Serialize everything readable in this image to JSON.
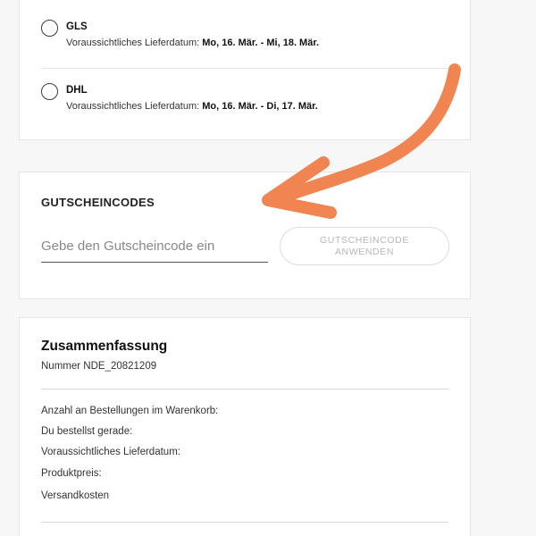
{
  "shipping": {
    "options": [
      {
        "carrier": "GLS",
        "eta_label": "Voraussichtliches Lieferdatum:",
        "eta_value": "Mo, 16. Mär. - Mi, 18. Mär."
      },
      {
        "carrier": "DHL",
        "eta_label": "Voraussichtliches Lieferdatum:",
        "eta_value": "Mo, 16. Mär. - Di, 17. Mär."
      }
    ]
  },
  "coupon": {
    "title": "GUTSCHEINCODES",
    "placeholder": "Gebe den Gutscheincode ein",
    "button_line1": "GUTSCHEINCODE",
    "button_line2": "ANWENDEN"
  },
  "summary": {
    "title": "Zusammenfassung",
    "number": "Nummer NDE_20821209",
    "lines": [
      "Anzahl an Bestellungen im Warenkorb:",
      "Du bestellst gerade:",
      "Voraussichtliches Lieferdatum:",
      "Produktpreis:",
      "Versandkosten"
    ]
  },
  "colors": {
    "arrow": "#f08552",
    "card_bg": "#ffffff",
    "page_bg": "#f7f7f7",
    "button_text": "#b7b7b7"
  },
  "icons": {
    "annotation": "curved-arrow-icon"
  }
}
